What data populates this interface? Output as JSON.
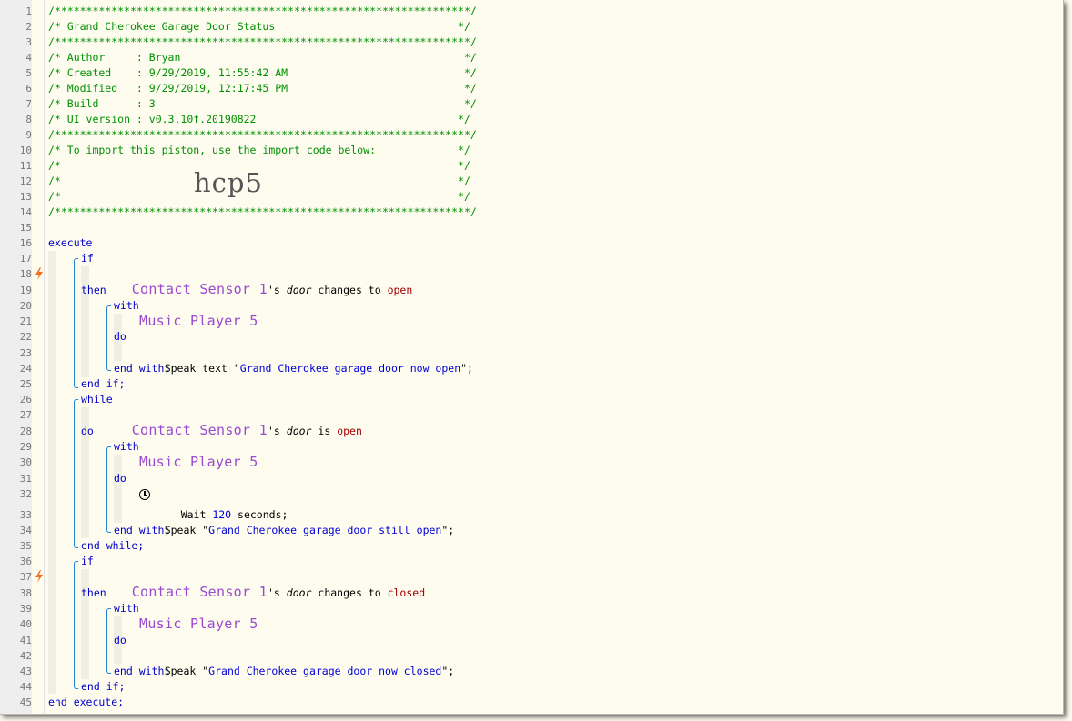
{
  "line_numbers": [
    "1",
    "2",
    "3",
    "4",
    "5",
    "6",
    "7",
    "8",
    "9",
    "10",
    "11",
    "12",
    "13",
    "14",
    "15",
    "16",
    "17",
    "18",
    "19",
    "20",
    "21",
    "22",
    "23",
    "24",
    "25",
    "26",
    "27",
    "28",
    "29",
    "30",
    "31",
    "32",
    "33",
    "34",
    "35",
    "36",
    "37",
    "38",
    "39",
    "40",
    "41",
    "42",
    "43",
    "44",
    "45"
  ],
  "header": {
    "rule_top": "/******************************************************************/",
    "title": "/* Grand Cherokee Garage Door Status                             */",
    "rule_title": "/******************************************************************/",
    "author": "/* Author     : Bryan                                             */",
    "created": "/* Created    : 9/29/2019, 11:55:42 AM                            */",
    "modified": "/* Modified   : 9/29/2019, 12:17:45 PM                            */",
    "build": "/* Build      : 3                                                 */",
    "ui_version": "/* UI version : v0.3.10f.20190822                                */",
    "rule_meta": "/******************************************************************/",
    "import_note": "/* To import this piston, use the import code below:             */",
    "blank_1": "/*                                                               */",
    "blank_2": "/*                                                               */",
    "blank_3": "/*                                                               */",
    "rule_bottom": "/******************************************************************/",
    "import_code": "hcp5"
  },
  "code": {
    "execute": "execute",
    "end_execute": "end execute;",
    "kw_if": "if",
    "kw_then": "then",
    "kw_with": "with",
    "kw_do": "do",
    "kw_end_with": "end with;",
    "kw_end_if": "end if;",
    "kw_while": "while",
    "kw_end_while": "end while;",
    "device_sensor": "Contact Sensor 1",
    "possessive": "'s ",
    "attribute": "door",
    "op_changes_to": " changes to ",
    "op_is": " is ",
    "val_open": "open",
    "val_closed": "closed",
    "device_player": "Music Player 5",
    "action_speak_text": "Speak text \"",
    "action_speak": "Speak \"",
    "msg_now_open": "Grand Cherokee garage door now open",
    "msg_still_open": "Grand Cherokee garage door still open",
    "msg_now_closed": "Grand Cherokee garage door now closed",
    "quote_end": "\";",
    "wait_prefix": "Wait ",
    "wait_value": "120",
    "wait_suffix": " seconds;"
  },
  "icons": {
    "trigger": "lightning-bolt-icon",
    "wait": "clock-icon"
  },
  "colors": {
    "comment": "#009000",
    "keyword": "#0000c8",
    "device": "#9a4ad0",
    "value": "#a00000",
    "trigger_bolt": "#f07020",
    "bracket": "#2580d0",
    "background": "#fdfcef"
  }
}
